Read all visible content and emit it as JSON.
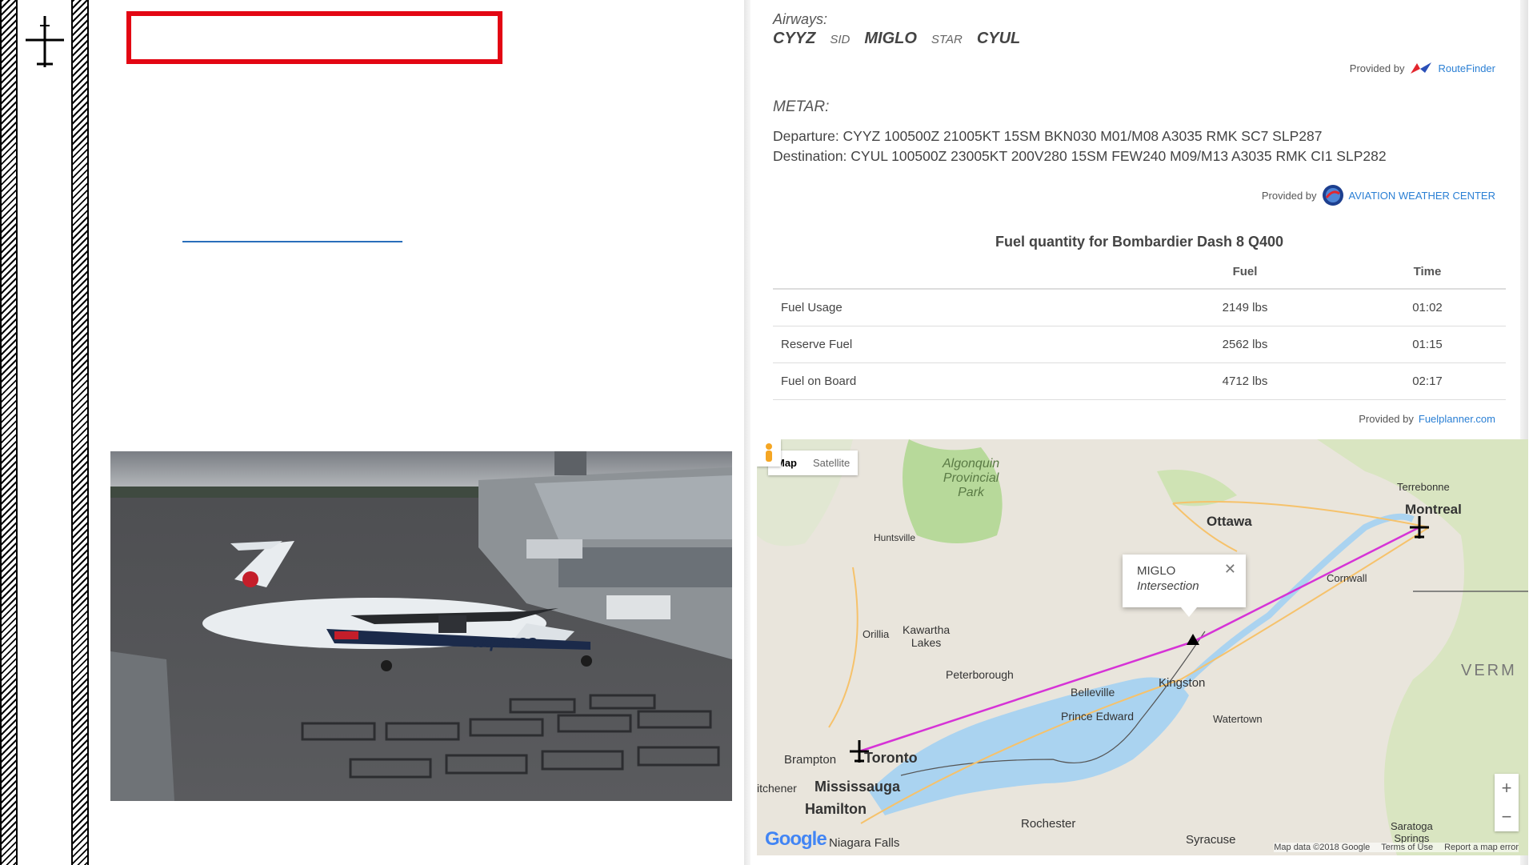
{
  "airways": {
    "label": "Airways:",
    "route": [
      {
        "kind": "wp",
        "text": "CYYZ"
      },
      {
        "kind": "proc",
        "text": "SID"
      },
      {
        "kind": "wp",
        "text": "MIGLO"
      },
      {
        "kind": "proc",
        "text": "STAR"
      },
      {
        "kind": "wp",
        "text": "CYUL"
      }
    ],
    "provided_by": "Provided by",
    "provider": "RouteFinder"
  },
  "metar": {
    "label": "METAR:",
    "departure": "Departure: CYYZ 100500Z 21005KT 15SM BKN030 M01/M08 A3035 RMK SC7 SLP287",
    "destination": "Destination: CYUL 100500Z 23005KT 200V280 15SM FEW240 M09/M13 A3035 RMK CI1 SLP282",
    "provided_by": "Provided by",
    "provider": "AVIATION WEATHER CENTER"
  },
  "fuel": {
    "title": "Fuel quantity for Bombardier Dash 8 Q400",
    "columns": [
      "",
      "Fuel",
      "Time"
    ],
    "rows": [
      [
        "Fuel Usage",
        "2149 lbs",
        "01:02"
      ],
      [
        "Reserve Fuel",
        "2562 lbs",
        "01:15"
      ],
      [
        "Fuel on Board",
        "4712 lbs",
        "02:17"
      ]
    ],
    "provided_by": "Provided by",
    "provider": "Fuelplanner.com"
  },
  "map": {
    "tabs": [
      "Map",
      "Satellite"
    ],
    "popup": {
      "title": "MIGLO",
      "subtitle": "Intersection"
    },
    "google": "Google",
    "attribution": [
      "Map data ©2018 Google",
      "Terms of Use",
      "Report a map error"
    ],
    "zoom_in": "+",
    "zoom_out": "−",
    "places": [
      {
        "text": "Algonquin\nProvincial\nPark"
      },
      {
        "text": "Ottawa"
      },
      {
        "text": "Montreal"
      },
      {
        "text": "Terrebonne"
      },
      {
        "text": "Huntsville"
      },
      {
        "text": "Orillia"
      },
      {
        "text": "Kawartha\nLakes"
      },
      {
        "text": "Peterborough"
      },
      {
        "text": "Kingston"
      },
      {
        "text": "Belleville"
      },
      {
        "text": "Prince Edward"
      },
      {
        "text": "Watertown"
      },
      {
        "text": "Cornwall"
      },
      {
        "text": "Brampton"
      },
      {
        "text": "Toronto"
      },
      {
        "text": "Mississauga"
      },
      {
        "text": "Hamilton"
      },
      {
        "text": "itchener"
      },
      {
        "text": "Niagara Falls"
      },
      {
        "text": "Rochester"
      },
      {
        "text": "Syracuse"
      },
      {
        "text": "Saratoga\nSprings"
      },
      {
        "text": "VERM"
      }
    ]
  },
  "colors": {
    "accent_red": "#e30613",
    "link_blue": "#2a7fd4",
    "route_magenta": "#d633d6"
  }
}
